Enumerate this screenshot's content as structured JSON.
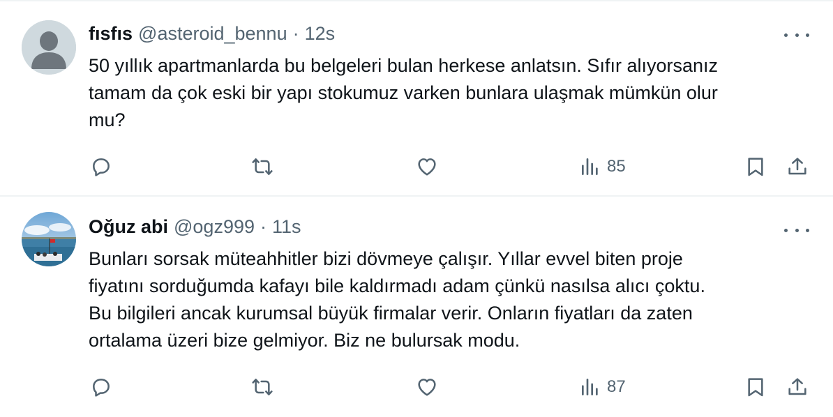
{
  "colors": {
    "text": "#0f1419",
    "muted": "#536471",
    "divider": "#eff3f4"
  },
  "tweets": [
    {
      "name": "fısfıs",
      "handle": "@asteroid_bennu",
      "separator": "·",
      "time": "12s",
      "text": "50 yıllık apartmanlarda bu belgeleri bulan herkese anlatsın. Sıfır alıyorsanız\ntamam da çok eski bir yapı stokumuz varken bunlara ulaşmak mümkün olur\nmu?",
      "views": "85",
      "avatar": "default-avatar-icon"
    },
    {
      "name": "Oğuz abi",
      "handle": "@ogz999",
      "separator": "·",
      "time": "11s",
      "text": "Bunları sorsak müteahhitler bizi dövmeye çalışır. Yıllar evvel biten proje\nfiyatını sorduğumda kafayı bile kaldırmadı adam çünkü nasılsa alıcı çoktu.\nBu bilgileri ancak kurumsal büyük firmalar verir. Onların fiyatları da zaten\nortalama üzeri bize gelmiyor. Biz ne bulursak modu.",
      "views": "87",
      "avatar": "sea-ferry-photo-avatar"
    }
  ],
  "icons": {
    "reply": "reply-icon",
    "retweet": "retweet-icon",
    "like": "like-icon",
    "views": "views-icon",
    "bookmark": "bookmark-icon",
    "share": "share-icon",
    "more": "more-icon"
  }
}
